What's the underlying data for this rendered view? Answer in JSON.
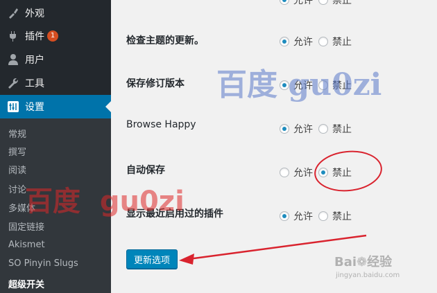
{
  "sidebar": {
    "menu": [
      {
        "label": "外观",
        "icon": "paintbrush-icon"
      },
      {
        "label": "插件",
        "icon": "plugin-icon",
        "badge": "1"
      },
      {
        "label": "用户",
        "icon": "user-icon"
      },
      {
        "label": "工具",
        "icon": "wrench-icon"
      },
      {
        "label": "设置",
        "icon": "settings-icon"
      }
    ],
    "submenu": [
      "常规",
      "撰写",
      "阅读",
      "讨论",
      "多媒体",
      "固定链接",
      "Akismet",
      "SO Pinyin Slugs",
      "超级开关"
    ]
  },
  "settings": {
    "rows": [
      {
        "label": "检查主题的更新。",
        "allow": "允许",
        "deny": "禁止",
        "selected": "allow"
      },
      {
        "label": "保存修订版本",
        "allow": "允许",
        "deny": "禁止",
        "selected": "allow"
      },
      {
        "label": "Browse Happy",
        "allow": "允许",
        "deny": "禁止",
        "selected": "allow"
      },
      {
        "label": "自动保存",
        "allow": "允许",
        "deny": "禁止",
        "selected": "deny"
      },
      {
        "label": "显示最近启用过的插件",
        "allow": "允许",
        "deny": "禁止",
        "selected": "allow"
      }
    ],
    "top_partial": {
      "allow": "允许",
      "deny": "禁止"
    }
  },
  "save_button": "更新选项",
  "watermarks": {
    "blue": "百度 gu0zi",
    "red": "百度  gu0zi",
    "baidu": "Bai",
    "baidu_jingyan": "经验",
    "baidu_url": "jingyan.baidu.com"
  },
  "colors": {
    "sidebar_bg": "#23282d",
    "submenu_bg": "#32373c",
    "active_bg": "#0073aa",
    "button_bg": "#0085ba",
    "badge_bg": "#d54e21",
    "annotation_red": "#d9232e"
  }
}
